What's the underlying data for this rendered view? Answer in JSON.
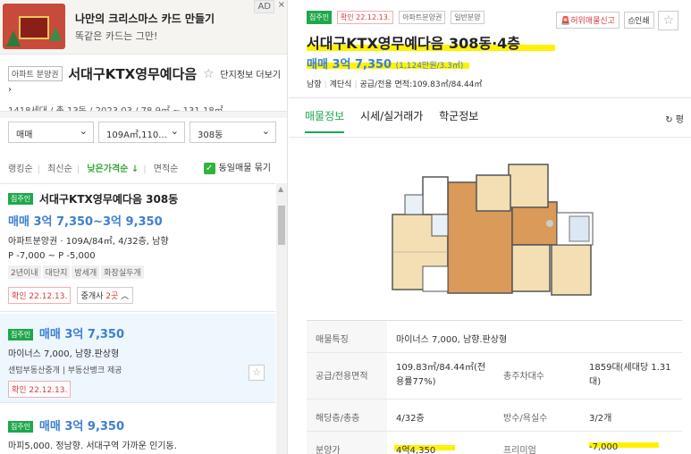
{
  "ad": {
    "title": "나만의 크리스마스 카드 만들기",
    "subtitle": "똑같은 카드는 그만!",
    "badge": "AD",
    "close": "×"
  },
  "complex": {
    "type_tag": "아파트 분양권",
    "name": "서대구KTX영무예다음",
    "star": "☆",
    "more": "단지정보 더보기 ›",
    "info": "1418세대 / 총 13동 / 2023.03 / 78.9㎡ ~ 131.18㎡"
  },
  "filters": {
    "trade": "매매",
    "area": "109A㎡,110...",
    "dong": "308동",
    "chevron": "⌄"
  },
  "sort": {
    "items": [
      "랭킹순",
      "최신순",
      "낮은가격순 ↓",
      "면적순"
    ],
    "same_listing": "동일매물 묶기",
    "check": "✓"
  },
  "listings": [
    {
      "tag": "집주인",
      "title": "서대구KTX영무예다음 308동",
      "price": "매매 3억 7,350~3억 9,350",
      "detail": "아파트분양권 · 109A/84㎡, 4/32층, 남향",
      "premium": "P -7,000 ~ P -5,000",
      "tags": [
        "2년이내",
        "대단지",
        "방세개",
        "화장실두개"
      ],
      "confirm": "확인 22.12.13.",
      "agent_label": "중개사",
      "agent_count": "2곳",
      "agent_chev": "︿"
    },
    {
      "tag": "집주인",
      "price": "매매 3억 7,350",
      "detail": "마이너스 7,000, 남향.판상형",
      "agency": "센텀부동산중개 | 부동산뱅크 제공",
      "confirm": "확인 22.12.13.",
      "star": "☆"
    },
    {
      "tag": "집주인",
      "price": "매매 3억 9,350",
      "detail": "마피5,000. 정남향. 서대구역 가까운 인기동."
    }
  ],
  "detail": {
    "tag": "집주인",
    "confirm": "확인 22.12.13.",
    "type": "아파트분양권",
    "sale_kind": "일반분양",
    "actions": {
      "report": "허위매물신고",
      "print": "인쇄",
      "star": "☆"
    },
    "title": "서대구KTX영무예다음 308동·4층",
    "price": "매매 3억 7,350",
    "per_area": "(1,124만원/3.3㎡)",
    "specs": [
      "남향",
      "계단식",
      "공급/전용 면적:109.83㎡/84.44㎡"
    ],
    "tabs": [
      "매물정보",
      "시세/실거래가",
      "학군정보"
    ],
    "refresh": "↻ 평",
    "table": [
      {
        "label": "매물특징",
        "value": "마이너스 7,000, 남향.판상형"
      },
      {
        "label": "공급/전용면적",
        "value": "109.83㎡/84.44㎡(전용률77%)",
        "label2": "총주차대수",
        "value2": "1859대(세대당 1.31대)"
      },
      {
        "label": "해당층/총층",
        "value": "4/32층",
        "label2": "방수/욕실수",
        "value2": "3/2개"
      },
      {
        "label": "분양가",
        "value": "4억4,350",
        "label2": "프리미엄",
        "value2": "-7,000"
      }
    ]
  },
  "colors": {
    "green": "#1ea84b",
    "blue_price": "#3c7fd1",
    "highlight": "#fff200",
    "red": "#d83b3b"
  }
}
